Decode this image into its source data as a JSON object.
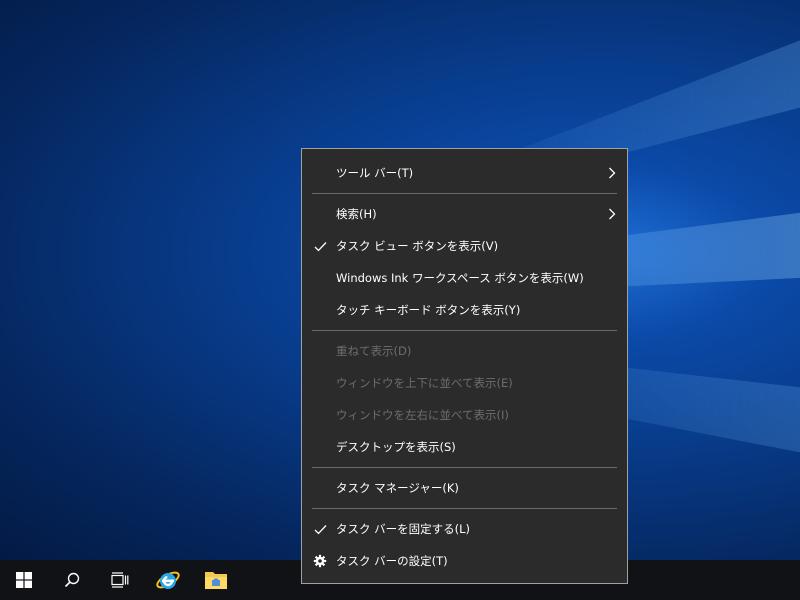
{
  "colors": {
    "menu_background": "#2b2b2b",
    "menu_border": "#a0a0a0",
    "menu_text": "#ffffff",
    "menu_disabled_text": "#6d6d6d",
    "separator": "#6a6a6a",
    "taskbar": "#101216"
  },
  "taskbar": {
    "items": [
      {
        "name": "start-button",
        "icon": "windows-logo-icon"
      },
      {
        "name": "search-button",
        "icon": "search-icon"
      },
      {
        "name": "task-view-button",
        "icon": "task-view-icon"
      },
      {
        "name": "internet-explorer-button",
        "icon": "internet-explorer-icon"
      },
      {
        "name": "file-explorer-button",
        "icon": "file-explorer-icon"
      }
    ]
  },
  "context_menu": {
    "items": [
      {
        "label": "ツール バー(T)",
        "submenu": true
      },
      {
        "label": "検索(H)",
        "submenu": true
      },
      {
        "label": "タスク ビュー ボタンを表示(V)",
        "checked": true
      },
      {
        "label": "Windows Ink ワークスペース ボタンを表示(W)"
      },
      {
        "label": "タッチ キーボード ボタンを表示(Y)"
      },
      {
        "label": "重ねて表示(D)",
        "disabled": true
      },
      {
        "label": "ウィンドウを上下に並べて表示(E)",
        "disabled": true
      },
      {
        "label": "ウィンドウを左右に並べて表示(I)",
        "disabled": true
      },
      {
        "label": "デスクトップを表示(S)"
      },
      {
        "label": "タスク マネージャー(K)"
      },
      {
        "label": "タスク バーを固定する(L)",
        "checked": true
      },
      {
        "label": "タスク バーの設定(T)",
        "icon": "gear-icon"
      }
    ]
  }
}
